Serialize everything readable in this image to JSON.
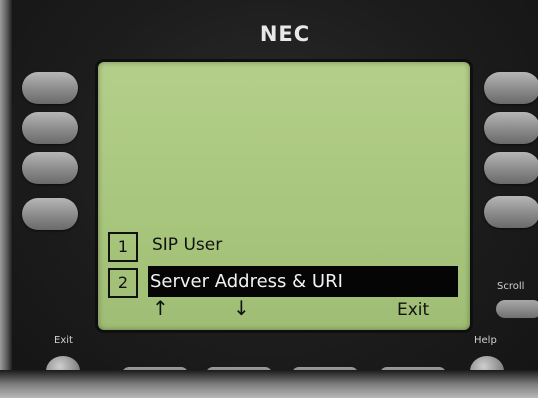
{
  "device": {
    "brand": "NEC"
  },
  "display": {
    "items": [
      {
        "number": "1",
        "label": "SIP User",
        "selected": false
      },
      {
        "number": "2",
        "label": "Server Address & URI",
        "selected": true
      }
    ],
    "nav_up": "↑",
    "nav_down": "↓",
    "softkey_exit": "Exit"
  },
  "hard_keys": {
    "exit_label": "Exit",
    "help_label": "Help",
    "scroll_label": "Scroll"
  }
}
